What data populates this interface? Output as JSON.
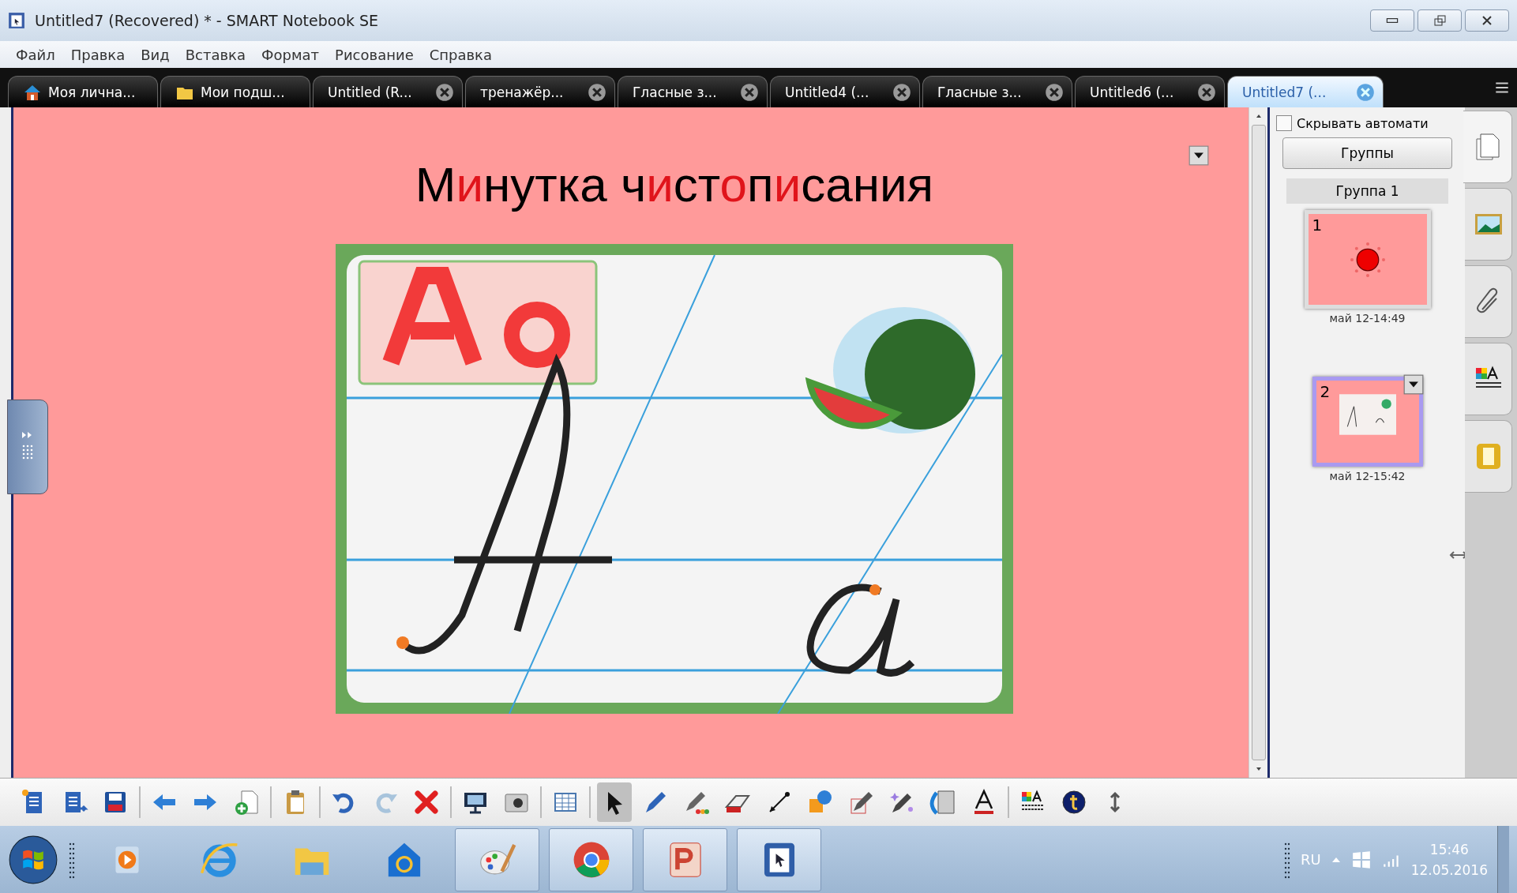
{
  "window": {
    "title": "Untitled7 (Recovered) * - SMART Notebook SE"
  },
  "menu": [
    "Файл",
    "Правка",
    "Вид",
    "Вставка",
    "Формат",
    "Рисование",
    "Справка"
  ],
  "tabs": [
    {
      "label": "Моя лична...",
      "kind": "home",
      "closable": false,
      "selected": false
    },
    {
      "label": "Мои подш...",
      "kind": "folder",
      "closable": false,
      "selected": false
    },
    {
      "label": "Untitled (R...",
      "kind": "document",
      "closable": true,
      "selected": false
    },
    {
      "label": "тренажёр...",
      "kind": "document",
      "closable": true,
      "selected": false
    },
    {
      "label": "Гласные з...",
      "kind": "document",
      "closable": true,
      "selected": false
    },
    {
      "label": "Untitled4 (...",
      "kind": "document",
      "closable": true,
      "selected": false
    },
    {
      "label": "Гласные з...",
      "kind": "document",
      "closable": true,
      "selected": false
    },
    {
      "label": "Untitled6 (...",
      "kind": "document",
      "closable": true,
      "selected": false
    },
    {
      "label": "Untitled7 (...",
      "kind": "document",
      "closable": true,
      "selected": true
    }
  ],
  "slide": {
    "title_segments": [
      {
        "text": "М",
        "color": "#000000"
      },
      {
        "text": "и",
        "color": "#e0141b"
      },
      {
        "text": "нутка ч",
        "color": "#000000"
      },
      {
        "text": "и",
        "color": "#e0141b"
      },
      {
        "text": "ст",
        "color": "#000000"
      },
      {
        "text": "о",
        "color": "#e0141b"
      },
      {
        "text": "п",
        "color": "#000000"
      },
      {
        "text": "и",
        "color": "#e0141b"
      },
      {
        "text": "сания",
        "color": "#000000"
      }
    ]
  },
  "side_panel": {
    "auto_hide": {
      "label": "Скрывать автомати",
      "checked": false
    },
    "groups_button": "Группы",
    "group_title": "Группа 1",
    "pages": [
      {
        "number": "1",
        "date": "май 12-14:49",
        "kind": "sun",
        "selected": false
      },
      {
        "number": "2",
        "date": "май 12-15:42",
        "kind": "card",
        "selected": true
      }
    ]
  },
  "side_tabs": [
    {
      "kind": "pages",
      "selected": true
    },
    {
      "kind": "gallery",
      "selected": false
    },
    {
      "kind": "attachments",
      "selected": false
    },
    {
      "kind": "properties",
      "selected": false
    },
    {
      "kind": "addons",
      "selected": false
    }
  ],
  "toolbar": [
    {
      "tools": [
        {
          "kind": "new-page",
          "selected": false
        },
        {
          "kind": "export",
          "selected": false
        },
        {
          "kind": "save",
          "selected": false
        }
      ]
    },
    {
      "tools": [
        {
          "kind": "back",
          "selected": false
        },
        {
          "kind": "forward",
          "selected": false
        },
        {
          "kind": "add-page",
          "selected": false
        }
      ]
    },
    {
      "tools": [
        {
          "kind": "paste",
          "selected": false
        }
      ]
    },
    {
      "tools": [
        {
          "kind": "undo",
          "selected": false
        },
        {
          "kind": "redo",
          "selected": false
        },
        {
          "kind": "delete",
          "selected": false
        }
      ]
    },
    {
      "tools": [
        {
          "kind": "screen",
          "selected": false
        },
        {
          "kind": "camera",
          "selected": false
        }
      ]
    },
    {
      "tools": [
        {
          "kind": "table",
          "selected": false
        }
      ]
    },
    {
      "tools": [
        {
          "kind": "select",
          "selected": true
        },
        {
          "kind": "pen",
          "selected": false
        },
        {
          "kind": "creative-pen",
          "selected": false
        },
        {
          "kind": "eraser",
          "selected": false
        },
        {
          "kind": "line",
          "selected": false
        },
        {
          "kind": "shapes",
          "selected": false
        },
        {
          "kind": "shape-pen",
          "selected": false
        },
        {
          "kind": "magic-pen",
          "selected": false
        },
        {
          "kind": "fill",
          "selected": false
        },
        {
          "kind": "text",
          "selected": false
        }
      ]
    },
    {
      "tools": [
        {
          "kind": "properties",
          "selected": false
        },
        {
          "kind": "tips",
          "selected": false
        },
        {
          "kind": "move-toolbar",
          "selected": false
        }
      ]
    }
  ],
  "taskbar": {
    "apps": [
      {
        "kind": "media",
        "active": false
      },
      {
        "kind": "browser-e",
        "active": false
      },
      {
        "kind": "files",
        "active": false
      },
      {
        "kind": "mail",
        "active": false
      },
      {
        "kind": "paint",
        "active": true
      },
      {
        "kind": "chrome",
        "active": true
      },
      {
        "kind": "slides",
        "active": true
      },
      {
        "kind": "notebook",
        "active": true
      }
    ],
    "language": "RU",
    "time": "15:46",
    "date": "12.05.2016"
  }
}
